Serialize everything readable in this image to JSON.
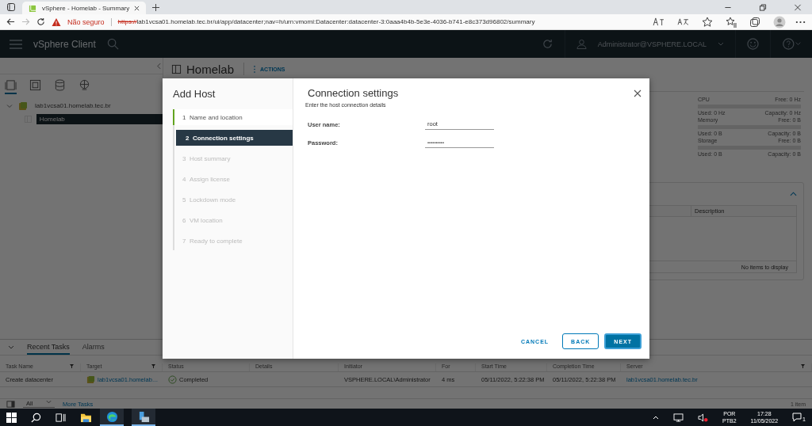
{
  "browser": {
    "tab_title": "vSphere - Homelab - Summary",
    "security": "Não seguro",
    "url_scheme": "https://",
    "url_rest": "lab1vcsa01.homelab.tec.br/ui/app/datacenter;nav=h/urn:vmomi:Datacenter:datacenter-3:0aaa4b4b-5e3e-4036-b741-e8c373d96802/summary"
  },
  "header": {
    "app_title": "vSphere Client",
    "user": "Administrator@VSPHERE.LOCAL"
  },
  "navigator": {
    "tree": [
      {
        "label": "lab1vcsa01.homelab.tec.br",
        "expanded": true,
        "selected": false,
        "children": [
          {
            "label": "Homelab",
            "selected": true
          }
        ]
      }
    ]
  },
  "object": {
    "title": "Homelab",
    "actions": "ACTIONS"
  },
  "resources": [
    {
      "name": "CPU",
      "free": "Free: 0 Hz",
      "used": "Used: 0 Hz",
      "capacity": "Capacity: 0 Hz"
    },
    {
      "name": "Memory",
      "free": "Free: 0 B",
      "used": "Used: 0 B",
      "capacity": "Capacity: 0 B"
    },
    {
      "name": "Storage",
      "free": "Free: 0 B",
      "used": "Used: 0 B",
      "capacity": "Capacity: 0 B"
    }
  ],
  "attributes": {
    "columns": [
      "Description"
    ],
    "empty": "No items to display"
  },
  "dialog": {
    "title": "Add Host",
    "heading": "Connection settings",
    "subtitle": "Enter the host connection details",
    "steps": [
      {
        "number": "1",
        "label": "Name and location",
        "selected": false,
        "completed": true,
        "disabled": false
      },
      {
        "number": "2",
        "label": "Connection settings",
        "selected": true,
        "completed": false,
        "disabled": false
      },
      {
        "number": "3",
        "label": "Host summary",
        "selected": false,
        "completed": false,
        "disabled": true
      },
      {
        "number": "4",
        "label": "Assign license",
        "selected": false,
        "completed": false,
        "disabled": true
      },
      {
        "number": "5",
        "label": "Lockdown mode",
        "selected": false,
        "completed": false,
        "disabled": true
      },
      {
        "number": "6",
        "label": "VM location",
        "selected": false,
        "completed": false,
        "disabled": true
      },
      {
        "number": "7",
        "label": "Ready to complete",
        "selected": false,
        "completed": false,
        "disabled": true
      }
    ],
    "fields": [
      {
        "label": "User name:",
        "value": "root",
        "kind": "text"
      },
      {
        "label": "Password:",
        "value": "••••••••••",
        "kind": "password"
      }
    ],
    "buttons": [
      {
        "label": "CANCEL",
        "kind": "link"
      },
      {
        "label": "BACK",
        "kind": "outline"
      },
      {
        "label": "NEXT",
        "kind": "primary"
      }
    ]
  },
  "tasks": {
    "tabs": [
      {
        "label": "Recent Tasks",
        "selected": true
      },
      {
        "label": "Alarms",
        "selected": false
      }
    ],
    "columns": [
      "Task Name",
      "Target",
      "Status",
      "Details",
      "Initiator",
      "For",
      "Start Time",
      "Completion Time",
      "Server"
    ],
    "rows": [
      {
        "task_name": "Create datacenter",
        "target": "lab1vcsa01.homelab…",
        "status": "Completed",
        "initiator": "VSPHERE.LOCAL\\Administrator",
        "queued": "4 ms",
        "start": "05/11/2022, 5:22:38 PM",
        "completion": "05/11/2022, 5:22:38 PM",
        "server": "lab1vcsa01.homelab.tec.br"
      }
    ],
    "filter": "All",
    "more": "More Tasks",
    "count": "1 item"
  },
  "taskbar": {
    "language": "POR",
    "layout": "PTB2",
    "time": "17:28",
    "date": "11/05/2022",
    "notifications": "1"
  }
}
